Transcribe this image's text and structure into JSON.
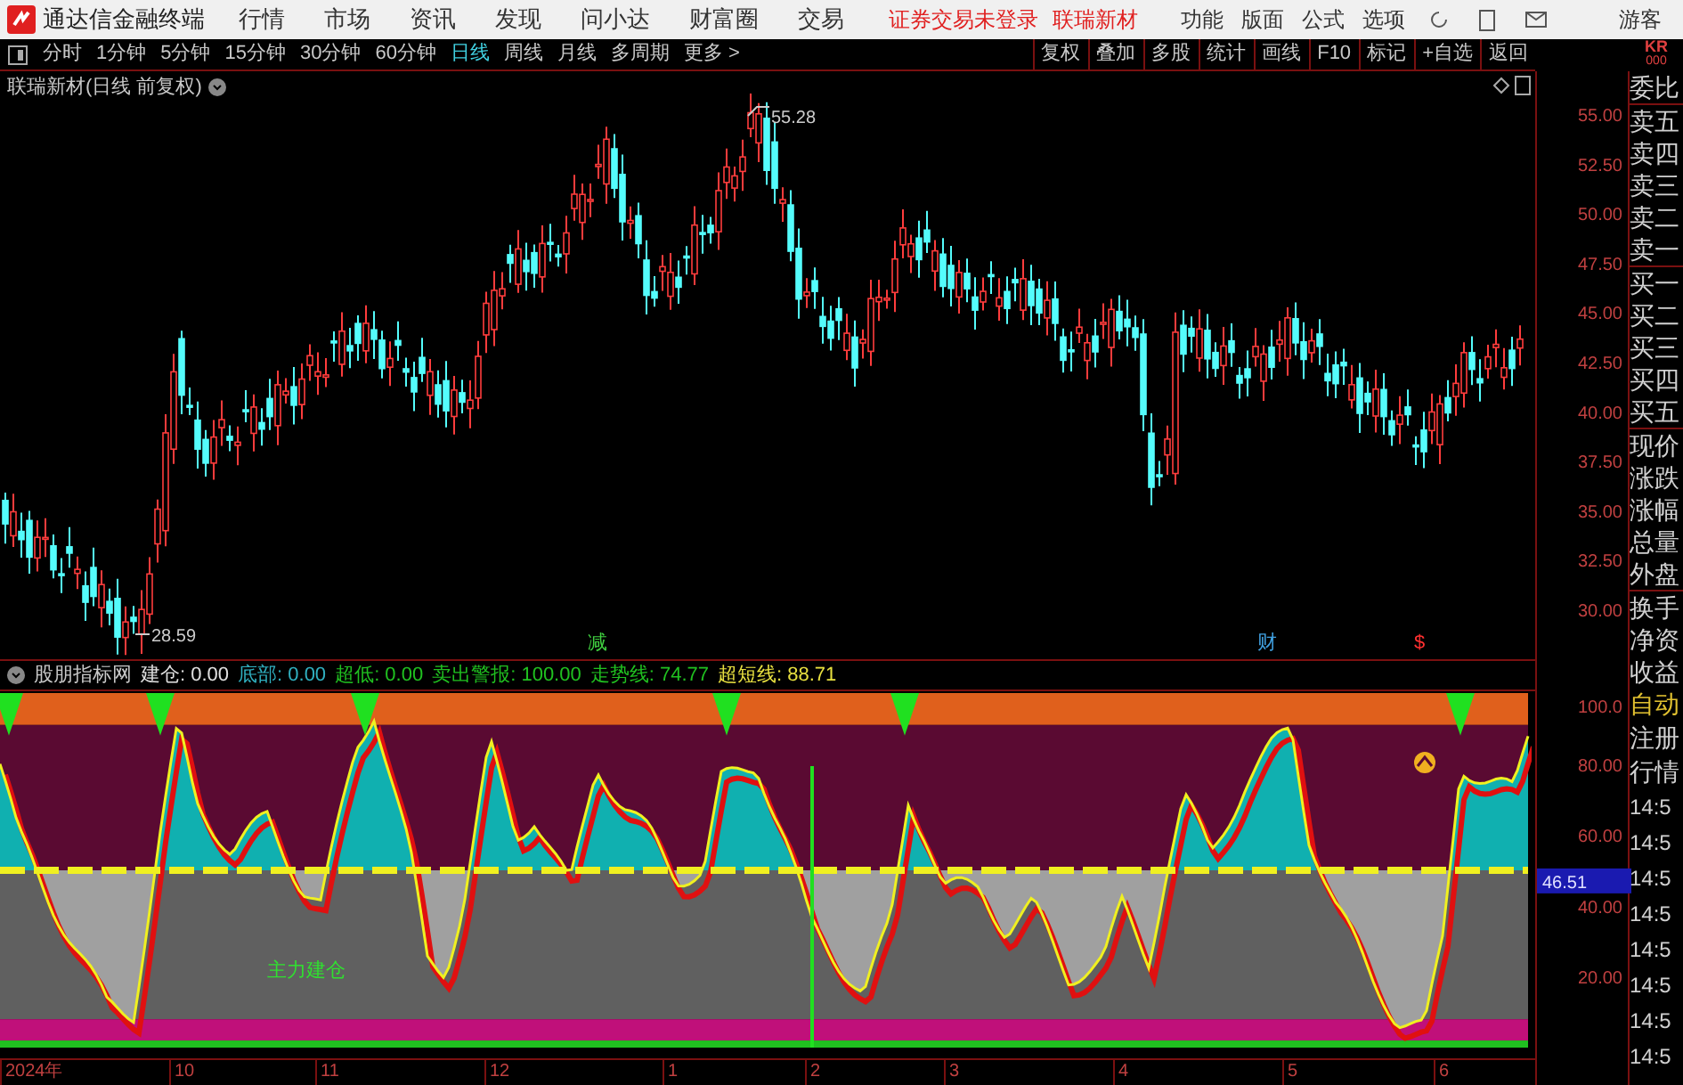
{
  "app": {
    "title": "通达信金融终端"
  },
  "menu": [
    "行情",
    "市场",
    "资讯",
    "发现",
    "问小达",
    "财富圈",
    "交易"
  ],
  "status_texts": [
    "证券交易未登录",
    "联瑞新材"
  ],
  "menu_right": [
    "功能",
    "版面",
    "公式",
    "选项"
  ],
  "user": "游客",
  "periods": [
    {
      "label": "分时",
      "selected": false
    },
    {
      "label": "1分钟",
      "selected": false
    },
    {
      "label": "5分钟",
      "selected": false
    },
    {
      "label": "15分钟",
      "selected": false
    },
    {
      "label": "30分钟",
      "selected": false
    },
    {
      "label": "60分钟",
      "selected": false
    },
    {
      "label": "日线",
      "selected": true
    },
    {
      "label": "周线",
      "selected": false
    },
    {
      "label": "月线",
      "selected": false
    },
    {
      "label": "多周期",
      "selected": false
    },
    {
      "label": "更多 >",
      "selected": false
    }
  ],
  "tools": [
    "复权",
    "叠加",
    "多股",
    "统计",
    "画线",
    "F10",
    "标记",
    "+自选",
    "返回"
  ],
  "corner": [
    "KR",
    "000"
  ],
  "price_chart": {
    "title": "联瑞新材(日线 前复权)",
    "high_label": "55.28",
    "low_label": "28.59",
    "axis": [
      "55.00",
      "52.50",
      "50.00",
      "47.50",
      "45.00",
      "42.50",
      "40.00",
      "37.50",
      "35.00",
      "32.50",
      "30.00"
    ],
    "markers": [
      {
        "text": "减",
        "color": "#40d040"
      },
      {
        "text": "财",
        "color": "#40a0e0"
      },
      {
        "text": "$",
        "color": "#ff3030"
      }
    ]
  },
  "indicator": {
    "name": "股朋指标网",
    "legend": [
      {
        "text": "建仓: 0.00",
        "color": "#e0e0e0"
      },
      {
        "text": "底部: 0.00",
        "color": "#30b0c0"
      },
      {
        "text": "超低: 0.00",
        "color": "#20c020"
      },
      {
        "text": "卖出警报: 100.00",
        "color": "#20c020"
      },
      {
        "text": "走势线: 74.77",
        "color": "#20c020"
      },
      {
        "text": "超短线: 88.71",
        "color": "#e8e040"
      }
    ],
    "signal_text": "主力建仓",
    "axis": [
      "100.0",
      "80.00",
      "60.00",
      "40.00",
      "20.00"
    ],
    "current": "46.51"
  },
  "x_axis": [
    "2024年",
    "10",
    "11",
    "12",
    "1",
    "2",
    "3",
    "4",
    "5",
    "6"
  ],
  "sidebar": [
    "委比",
    "卖五",
    "卖四",
    "卖三",
    "卖二",
    "卖一",
    "买一",
    "买二",
    "买三",
    "买四",
    "买五",
    "现价",
    "涨跌",
    "涨幅",
    "总量",
    "外盘",
    "换手",
    "净资",
    "收益"
  ],
  "sidebar_links": [
    "自动",
    "注册",
    "行情"
  ],
  "ticks": [
    "14:5",
    "14:5",
    "14:5",
    "14:5",
    "14:5",
    "14:5",
    "14:5",
    "14:5"
  ]
}
